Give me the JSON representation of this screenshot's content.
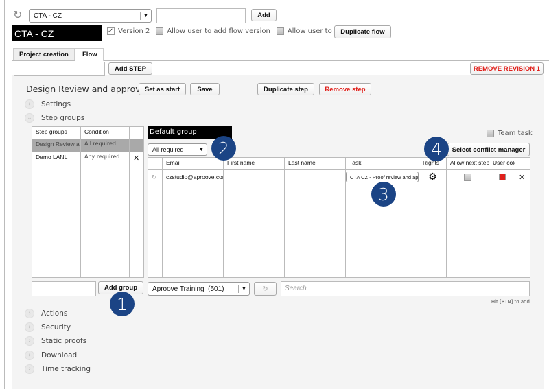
{
  "header": {
    "flow_select": "CTA - CZ",
    "add_label": "Add",
    "flow_title": "CTA - CZ",
    "version_label": "Version 2",
    "allow_flow_version": "Allow user to add flow version",
    "allow_add_step": "Allow user to add step",
    "duplicate_flow": "Duplicate flow"
  },
  "tabs": [
    {
      "label": "Project creation"
    },
    {
      "label": "Flow"
    }
  ],
  "toolbar": {
    "add_step": "Add STEP",
    "remove_revision": "REMOVE REVISION 1"
  },
  "step": {
    "title": "Design Review and approval",
    "set_as_start": "Set as start",
    "save": "Save",
    "duplicate_step": "Duplicate step",
    "remove_step": "Remove step"
  },
  "sections": {
    "settings": "Settings",
    "step_groups": "Step groups",
    "actions": "Actions",
    "security": "Security",
    "static_proofs": "Static proofs",
    "download": "Download",
    "time_tracking": "Time tracking"
  },
  "groups_table": {
    "headers": [
      "Step groups",
      "Condition"
    ],
    "rows": [
      {
        "name": "Design Review ar",
        "condition": "All required"
      },
      {
        "name": "Demo LANL",
        "condition": "Any required"
      }
    ]
  },
  "group": {
    "name": "Default group",
    "condition": "All required",
    "team_task": "Team task",
    "select_conflict_manager": "Select conflict manager"
  },
  "users_table": {
    "headers": [
      "Email",
      "First name",
      "Last name",
      "Task",
      "Rights",
      "Allow next step",
      "User color"
    ],
    "rows": [
      {
        "email": "czstudio@aproove.com",
        "first": "",
        "last": "",
        "task": "CTA CZ - Proof review and approval"
      }
    ]
  },
  "bottom": {
    "add_group": "Add group",
    "org_select": "Aproove Training  (501)",
    "search_placeholder": "Search",
    "hint": "Hit [RTN] to add"
  },
  "badges": [
    "1",
    "2",
    "3",
    "4"
  ],
  "colors": {
    "badge": "#1b4485",
    "remove": "#e0201b",
    "user_color": "#e0201b"
  }
}
